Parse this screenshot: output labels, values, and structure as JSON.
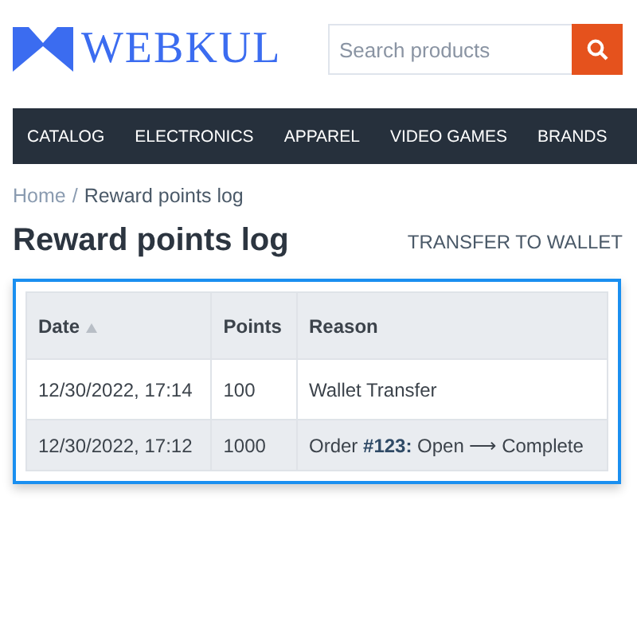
{
  "header": {
    "logo_text": "WEBKUL",
    "search": {
      "placeholder": "Search products"
    }
  },
  "nav": {
    "items": [
      "CATALOG",
      "ELECTRONICS",
      "APPAREL",
      "VIDEO GAMES",
      "BRANDS"
    ]
  },
  "breadcrumb": {
    "items": [
      "Home",
      "Reward points log"
    ],
    "separator": "/"
  },
  "page": {
    "title": "Reward points log",
    "action": "TRANSFER TO WALLET"
  },
  "table": {
    "columns": [
      {
        "label": "Date",
        "sortable": true
      },
      {
        "label": "Points",
        "sortable": false
      },
      {
        "label": "Reason",
        "sortable": false
      }
    ],
    "rows": [
      [
        "12/30/2022, 17:14",
        "100",
        "Wallet Transfer"
      ],
      [
        "12/30/2022, 17:12",
        "1000",
        "Order **#123:** Open ⟶ Complete"
      ]
    ]
  }
}
